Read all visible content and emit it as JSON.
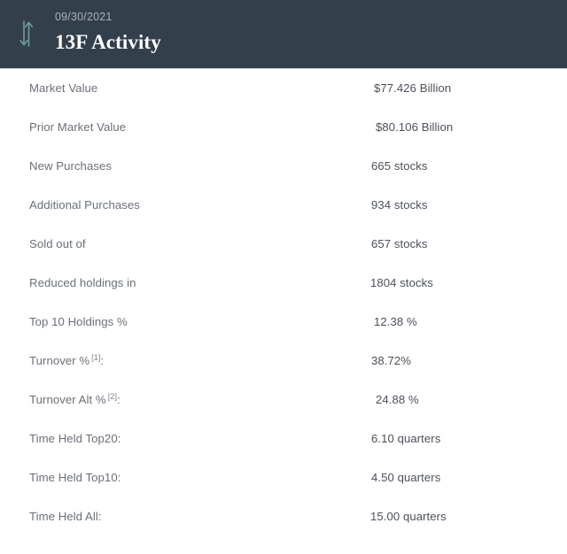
{
  "header": {
    "date": "09/30/2021",
    "title": "13F Activity",
    "icon": "up-down-arrow-icon",
    "bg_color": "#343f4c",
    "title_color": "#ffffff",
    "date_color": "#a9b2bb",
    "icon_color": "#6e9e94"
  },
  "table": {
    "rows": [
      {
        "label": "Market Value",
        "value": "$77.426 Billion"
      },
      {
        "label": "Prior Market Value",
        "value": "$80.106 Billion"
      },
      {
        "label": "New Purchases",
        "value": "665 stocks"
      },
      {
        "label": "Additional Purchases",
        "value": "934 stocks"
      },
      {
        "label": "Sold out of",
        "value": "657 stocks"
      },
      {
        "label": "Reduced holdings in",
        "value": "1804 stocks"
      },
      {
        "label": "Top 10 Holdings %",
        "value": "12.38 %"
      },
      {
        "label": "Turnover %",
        "footnote": "[1]",
        "suffix": ":",
        "value": "38.72%"
      },
      {
        "label": "Turnover Alt %",
        "footnote": "[2]",
        "suffix": ":",
        "value": "24.88 %"
      },
      {
        "label": "Time Held Top20:",
        "value": "6.10 quarters"
      },
      {
        "label": "Time Held Top10:",
        "value": "4.50 quarters"
      },
      {
        "label": "Time Held All:",
        "value": "15.00 quarters"
      }
    ]
  }
}
